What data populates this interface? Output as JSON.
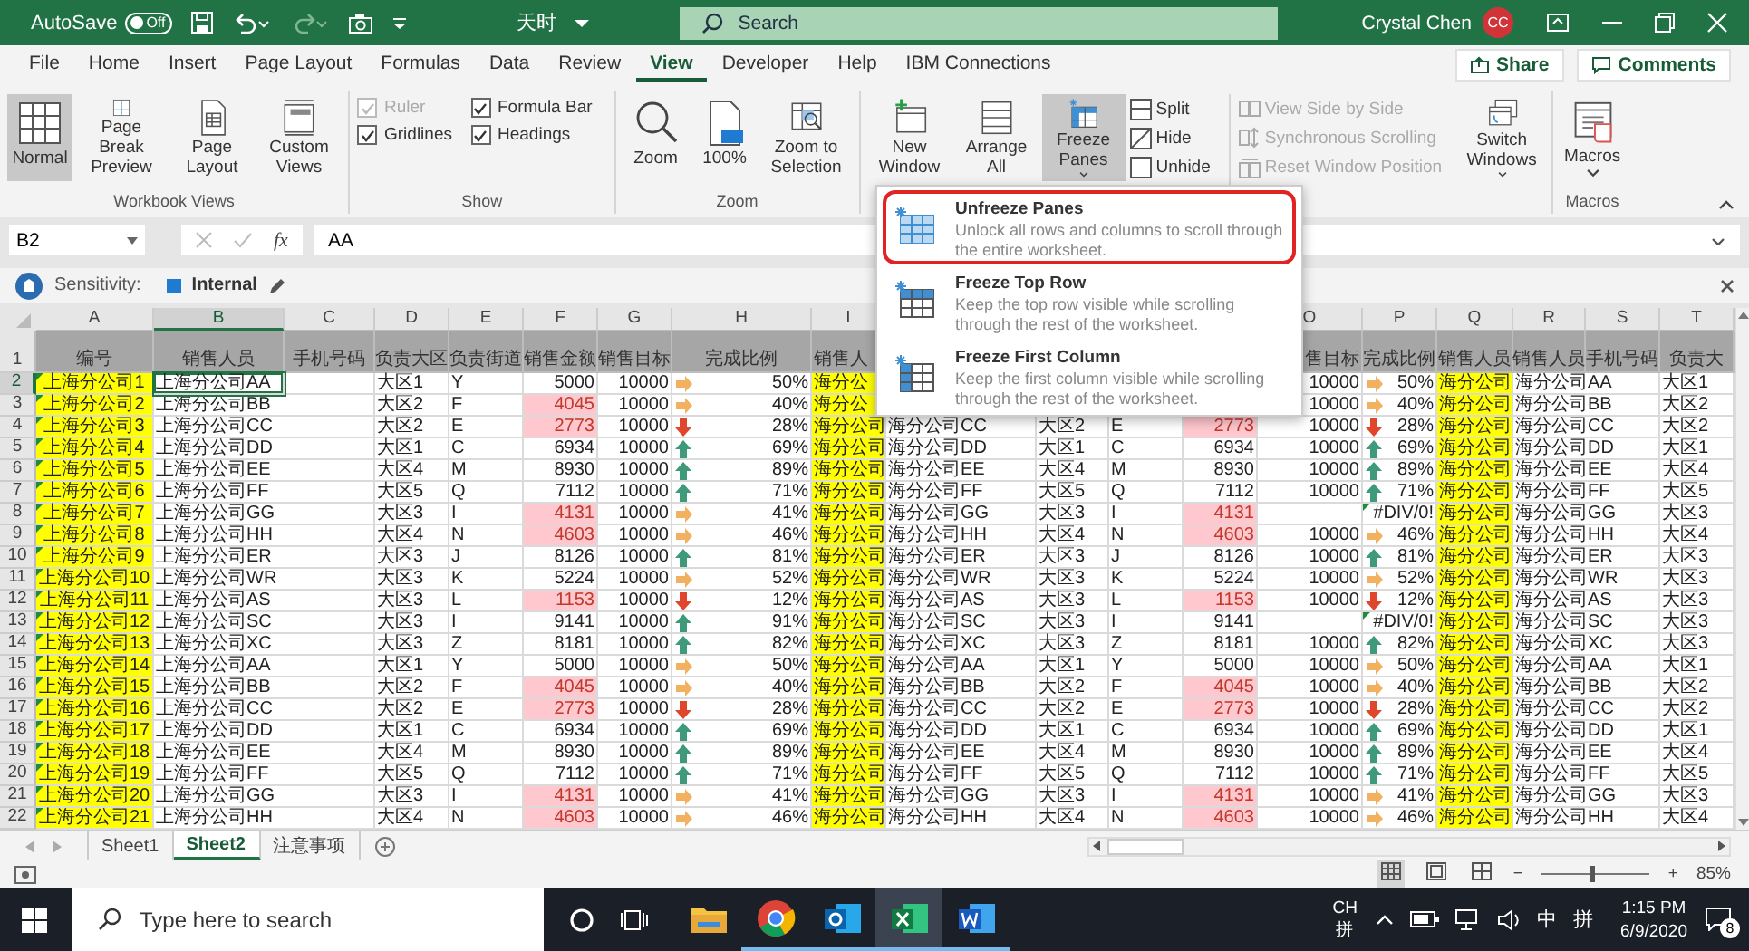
{
  "titlebar": {
    "autosave_label": "AutoSave",
    "autosave_toggle": {
      "label": "Off",
      "on": false
    },
    "title": "天时",
    "search": {
      "placeholder": "Search"
    },
    "user": "Crystal Chen",
    "avatar": "CC"
  },
  "menubar": {
    "tabs": [
      {
        "label": "File",
        "selected": false
      },
      {
        "label": "Home",
        "selected": false
      },
      {
        "label": "Insert",
        "selected": false
      },
      {
        "label": "Page Layout",
        "selected": false
      },
      {
        "label": "Formulas",
        "selected": false
      },
      {
        "label": "Data",
        "selected": false
      },
      {
        "label": "Review",
        "selected": false
      },
      {
        "label": "View",
        "selected": true
      },
      {
        "label": "Developer",
        "selected": false
      },
      {
        "label": "Help",
        "selected": false
      },
      {
        "label": "IBM Connections",
        "selected": false
      }
    ],
    "share": "Share",
    "comments": "Comments"
  },
  "ribbon": {
    "groups": [
      {
        "label": "Workbook Views",
        "items": [
          {
            "kind": "large",
            "label": "Normal",
            "selected": true
          },
          {
            "kind": "large",
            "label": "Page Break Preview",
            "selected": false
          },
          {
            "kind": "large",
            "label": "Page Layout",
            "selected": false
          },
          {
            "kind": "large",
            "label": "Custom Views",
            "selected": false
          }
        ]
      },
      {
        "label": "Show",
        "items": [
          {
            "kind": "stack",
            "items": [
              {
                "kind": "check",
                "label": "Ruler",
                "checked": true,
                "disabled": true
              },
              {
                "kind": "check",
                "label": "Gridlines",
                "checked": true,
                "disabled": false
              }
            ]
          },
          {
            "kind": "stack",
            "items": [
              {
                "kind": "check",
                "label": "Formula Bar",
                "checked": true,
                "disabled": false
              },
              {
                "kind": "check",
                "label": "Headings",
                "checked": true,
                "disabled": false
              }
            ]
          }
        ]
      },
      {
        "label": "Zoom",
        "items": [
          {
            "kind": "large",
            "label": "Zoom"
          },
          {
            "kind": "large",
            "label": "100%"
          },
          {
            "kind": "large",
            "label": "Zoom to Selection"
          }
        ]
      },
      {
        "items": [
          {
            "kind": "large",
            "label": "New Window"
          },
          {
            "kind": "large",
            "label": "Arrange All"
          },
          {
            "kind": "large",
            "label": "Freeze Panes",
            "dropdown": true,
            "expanded": true
          },
          {
            "kind": "stack",
            "items": [
              {
                "kind": "small",
                "label": "Split",
                "disabled": false
              },
              {
                "kind": "small",
                "label": "Hide",
                "disabled": false
              },
              {
                "kind": "small",
                "label": "Unhide",
                "disabled": false
              }
            ]
          },
          {
            "kind": "stack",
            "items": [
              {
                "kind": "small",
                "label": "View Side by Side",
                "disabled": true
              },
              {
                "kind": "small",
                "label": "Synchronous Scrolling",
                "disabled": true
              },
              {
                "kind": "small",
                "label": "Reset Window Position",
                "disabled": true
              }
            ]
          },
          {
            "kind": "large",
            "label": "Switch Windows",
            "dropdown": true
          }
        ]
      },
      {
        "label": "Macros",
        "items": [
          {
            "kind": "large",
            "label": "Macros",
            "dropdown": true
          }
        ]
      }
    ]
  },
  "formula_bar": {
    "name_box": "B2",
    "fx": "fx",
    "value": "AA"
  },
  "sensitivity": {
    "label": "Sensitivity:",
    "value": "Internal"
  },
  "sheet": {
    "columns": [
      {
        "letter": "A",
        "selected": false,
        "highlight": true,
        "flagged": true
      },
      {
        "letter": "B",
        "selected": true
      },
      {
        "letter": "C",
        "selected": false
      },
      {
        "letter": "D",
        "selected": false
      },
      {
        "letter": "E",
        "selected": false
      },
      {
        "letter": "F",
        "selected": false
      },
      {
        "letter": "G",
        "selected": false
      },
      {
        "letter": "H",
        "selected": false
      },
      {
        "letter": "I",
        "selected": false,
        "highlight": true
      },
      null,
      null,
      null,
      null,
      {
        "letter": "O",
        "selected": false
      },
      {
        "letter": "P",
        "selected": false
      },
      {
        "letter": "Q",
        "selected": false,
        "highlight": true
      },
      {
        "letter": "R",
        "selected": false
      },
      {
        "letter": "S",
        "selected": false
      },
      {
        "letter": "T",
        "selected": false
      }
    ],
    "rows": [
      {
        "num": "1",
        "kind": "header",
        "selected": false,
        "cells": [
          "编号",
          "销售人员",
          "手机号码",
          "负责大区",
          "负责街道",
          "销售金额",
          "销售目标",
          "完成比例",
          "销售人",
          null,
          null,
          null,
          null,
          "售目标",
          "完成比例",
          "销售人员",
          "销售人员",
          "手机号码",
          "负责大"
        ]
      },
      {
        "num": "2",
        "selected": true,
        "cells": [
          "上海分公司1",
          "上海分公司AA",
          null,
          "大区1",
          "Y",
          "5000",
          "10000",
          {
            "kind": "right",
            "text": "50%"
          },
          "海分公",
          null,
          null,
          null,
          null,
          "10000",
          {
            "kind": "right",
            "text": "50%"
          },
          "海分公司",
          "海分公司AA",
          null,
          "大区1"
        ]
      },
      {
        "num": "3",
        "selected": false,
        "cells": [
          "上海分公司2",
          "上海分公司BB",
          null,
          "大区2",
          "F",
          {
            "text": "4045",
            "low": true
          },
          "10000",
          {
            "kind": "right",
            "text": "40%"
          },
          "海分公",
          null,
          null,
          null,
          null,
          "10000",
          {
            "kind": "right",
            "text": "40%"
          },
          "海分公司",
          "海分公司BB",
          null,
          "大区2"
        ]
      },
      {
        "num": "4",
        "selected": false,
        "cells": [
          "上海分公司3",
          "上海分公司CC",
          null,
          "大区2",
          "E",
          {
            "text": "2773",
            "low": true
          },
          "10000",
          {
            "kind": "down",
            "text": "28%"
          },
          "海分公司",
          "海分公司CC",
          "大区2",
          "E",
          {
            "text": "2773",
            "low": true
          },
          "10000",
          {
            "kind": "down",
            "text": "28%"
          },
          "海分公司",
          "海分公司CC",
          null,
          "大区2"
        ]
      },
      {
        "num": "5",
        "selected": false,
        "cells": [
          "上海分公司4",
          "上海分公司DD",
          null,
          "大区1",
          "C",
          "6934",
          "10000",
          {
            "kind": "up",
            "text": "69%"
          },
          "海分公司",
          "海分公司DD",
          "大区1",
          "C",
          "6934",
          "10000",
          {
            "kind": "up",
            "text": "69%"
          },
          "海分公司",
          "海分公司DD",
          null,
          "大区1"
        ]
      },
      {
        "num": "6",
        "selected": false,
        "cells": [
          "上海分公司5",
          "上海分公司EE",
          null,
          "大区4",
          "M",
          "8930",
          "10000",
          {
            "kind": "up",
            "text": "89%"
          },
          "海分公司",
          "海分公司EE",
          "大区4",
          "M",
          "8930",
          "10000",
          {
            "kind": "up",
            "text": "89%"
          },
          "海分公司",
          "海分公司EE",
          null,
          "大区4"
        ]
      },
      {
        "num": "7",
        "selected": false,
        "cells": [
          "上海分公司6",
          "上海分公司FF",
          null,
          "大区5",
          "Q",
          "7112",
          "10000",
          {
            "kind": "up",
            "text": "71%"
          },
          "海分公司",
          "海分公司FF",
          "大区5",
          "Q",
          "7112",
          "10000",
          {
            "kind": "up",
            "text": "71%"
          },
          "海分公司",
          "海分公司FF",
          null,
          "大区5"
        ]
      },
      {
        "num": "8",
        "selected": false,
        "cells": [
          "上海分公司7",
          "上海分公司GG",
          null,
          "大区3",
          "I",
          {
            "text": "4131",
            "low": true
          },
          "10000",
          {
            "kind": "right",
            "text": "41%"
          },
          "海分公司",
          "海分公司GG",
          "大区3",
          "I",
          {
            "text": "4131",
            "low": true
          },
          null,
          {
            "text": "#DIV/0!",
            "flag": true
          },
          "海分公司",
          "海分公司GG",
          null,
          "大区3"
        ]
      },
      {
        "num": "9",
        "selected": false,
        "cells": [
          "上海分公司8",
          "上海分公司HH",
          null,
          "大区4",
          "N",
          {
            "text": "4603",
            "low": true
          },
          "10000",
          {
            "kind": "right",
            "text": "46%"
          },
          "海分公司",
          "海分公司HH",
          "大区4",
          "N",
          {
            "text": "4603",
            "low": true
          },
          "10000",
          {
            "kind": "right",
            "text": "46%"
          },
          "海分公司",
          "海分公司HH",
          null,
          "大区4"
        ]
      },
      {
        "num": "10",
        "selected": false,
        "cells": [
          "上海分公司9",
          "上海分公司ER",
          null,
          "大区3",
          "J",
          "8126",
          "10000",
          {
            "kind": "up",
            "text": "81%"
          },
          "海分公司",
          "海分公司ER",
          "大区3",
          "J",
          "8126",
          "10000",
          {
            "kind": "up",
            "text": "81%"
          },
          "海分公司",
          "海分公司ER",
          null,
          "大区3"
        ]
      },
      {
        "num": "11",
        "selected": false,
        "cells": [
          "上海分公司10",
          "上海分公司WR",
          null,
          "大区3",
          "K",
          "5224",
          "10000",
          {
            "kind": "right",
            "text": "52%"
          },
          "海分公司",
          "海分公司WR",
          "大区3",
          "K",
          "5224",
          "10000",
          {
            "kind": "right",
            "text": "52%"
          },
          "海分公司",
          "海分公司WR",
          null,
          "大区3"
        ]
      },
      {
        "num": "12",
        "selected": false,
        "cells": [
          "上海分公司11",
          "上海分公司AS",
          null,
          "大区3",
          "L",
          {
            "text": "1153",
            "low": true
          },
          "10000",
          {
            "kind": "down",
            "text": "12%"
          },
          "海分公司",
          "海分公司AS",
          "大区3",
          "L",
          {
            "text": "1153",
            "low": true
          },
          "10000",
          {
            "kind": "down",
            "text": "12%"
          },
          "海分公司",
          "海分公司AS",
          null,
          "大区3"
        ]
      },
      {
        "num": "13",
        "selected": false,
        "cells": [
          "上海分公司12",
          "上海分公司SC",
          null,
          "大区3",
          "I",
          "9141",
          "10000",
          {
            "kind": "up",
            "text": "91%"
          },
          "海分公司",
          "海分公司SC",
          "大区3",
          "I",
          "9141",
          null,
          {
            "text": "#DIV/0!",
            "flag": true
          },
          "海分公司",
          "海分公司SC",
          null,
          "大区3"
        ]
      },
      {
        "num": "14",
        "selected": false,
        "cells": [
          "上海分公司13",
          "上海分公司XC",
          null,
          "大区3",
          "Z",
          "8181",
          "10000",
          {
            "kind": "up",
            "text": "82%"
          },
          "海分公司",
          "海分公司XC",
          "大区3",
          "Z",
          "8181",
          "10000",
          {
            "kind": "up",
            "text": "82%"
          },
          "海分公司",
          "海分公司XC",
          null,
          "大区3"
        ]
      },
      {
        "num": "15",
        "selected": false,
        "cells": [
          "上海分公司14",
          "上海分公司AA",
          null,
          "大区1",
          "Y",
          "5000",
          "10000",
          {
            "kind": "right",
            "text": "50%"
          },
          "海分公司",
          "海分公司AA",
          "大区1",
          "Y",
          "5000",
          "10000",
          {
            "kind": "right",
            "text": "50%"
          },
          "海分公司",
          "海分公司AA",
          null,
          "大区1"
        ]
      },
      {
        "num": "16",
        "selected": false,
        "cells": [
          "上海分公司15",
          "上海分公司BB",
          null,
          "大区2",
          "F",
          {
            "text": "4045",
            "low": true
          },
          "10000",
          {
            "kind": "right",
            "text": "40%"
          },
          "海分公司",
          "海分公司BB",
          "大区2",
          "F",
          {
            "text": "4045",
            "low": true
          },
          "10000",
          {
            "kind": "right",
            "text": "40%"
          },
          "海分公司",
          "海分公司BB",
          null,
          "大区2"
        ]
      },
      {
        "num": "17",
        "selected": false,
        "cells": [
          "上海分公司16",
          "上海分公司CC",
          null,
          "大区2",
          "E",
          {
            "text": "2773",
            "low": true
          },
          "10000",
          {
            "kind": "down",
            "text": "28%"
          },
          "海分公司",
          "海分公司CC",
          "大区2",
          "E",
          {
            "text": "2773",
            "low": true
          },
          "10000",
          {
            "kind": "down",
            "text": "28%"
          },
          "海分公司",
          "海分公司CC",
          null,
          "大区2"
        ]
      },
      {
        "num": "18",
        "selected": false,
        "cells": [
          "上海分公司17",
          "上海分公司DD",
          null,
          "大区1",
          "C",
          "6934",
          "10000",
          {
            "kind": "up",
            "text": "69%"
          },
          "海分公司",
          "海分公司DD",
          "大区1",
          "C",
          "6934",
          "10000",
          {
            "kind": "up",
            "text": "69%"
          },
          "海分公司",
          "海分公司DD",
          null,
          "大区1"
        ]
      },
      {
        "num": "19",
        "selected": false,
        "cells": [
          "上海分公司18",
          "上海分公司EE",
          null,
          "大区4",
          "M",
          "8930",
          "10000",
          {
            "kind": "up",
            "text": "89%"
          },
          "海分公司",
          "海分公司EE",
          "大区4",
          "M",
          "8930",
          "10000",
          {
            "kind": "up",
            "text": "89%"
          },
          "海分公司",
          "海分公司EE",
          null,
          "大区4"
        ]
      },
      {
        "num": "20",
        "selected": false,
        "cells": [
          "上海分公司19",
          "上海分公司FF",
          null,
          "大区5",
          "Q",
          "7112",
          "10000",
          {
            "kind": "up",
            "text": "71%"
          },
          "海分公司",
          "海分公司FF",
          "大区5",
          "Q",
          "7112",
          "10000",
          {
            "kind": "up",
            "text": "71%"
          },
          "海分公司",
          "海分公司FF",
          null,
          "大区5"
        ]
      },
      {
        "num": "21",
        "selected": false,
        "cells": [
          "上海分公司20",
          "上海分公司GG",
          null,
          "大区3",
          "I",
          {
            "text": "4131",
            "low": true
          },
          "10000",
          {
            "kind": "right",
            "text": "41%"
          },
          "海分公司",
          "海分公司GG",
          "大区3",
          "I",
          {
            "text": "4131",
            "low": true
          },
          "10000",
          {
            "kind": "right",
            "text": "41%"
          },
          "海分公司",
          "海分公司GG",
          null,
          "大区3"
        ]
      },
      {
        "num": "22",
        "selected": false,
        "cells": [
          "上海分公司21",
          "上海分公司HH",
          null,
          "大区4",
          "N",
          {
            "text": "4603",
            "low": true
          },
          "10000",
          {
            "kind": "right",
            "text": "46%"
          },
          "海分公司",
          "海分公司HH",
          "大区4",
          "N",
          {
            "text": "4603",
            "low": true
          },
          "10000",
          {
            "kind": "right",
            "text": "46%"
          },
          "海分公司",
          "海分公司HH",
          null,
          "大区4"
        ]
      }
    ]
  },
  "freeze_menu": {
    "items": [
      {
        "title": "Unfreeze Panes",
        "description": "Unlock all rows and columns to scroll through the entire worksheet.",
        "highlighted": true
      },
      {
        "title": "Freeze Top Row",
        "description": "Keep the top row visible while scrolling through the rest of the worksheet.",
        "highlighted": false
      },
      {
        "title": "Freeze First Column",
        "description": "Keep the first column visible while scrolling through the rest of the worksheet.",
        "highlighted": false
      }
    ]
  },
  "sheet_tabs": [
    {
      "label": "Sheet1",
      "selected": false
    },
    {
      "label": "Sheet2",
      "selected": true
    },
    {
      "label": "注意事项",
      "selected": false
    }
  ],
  "status_bar": {
    "views": [
      {
        "selected": true
      },
      {
        "selected": false
      },
      {
        "selected": false
      }
    ],
    "zoom_out": "−",
    "zoom_slider": {
      "level": 0.45
    },
    "zoom_in": "+",
    "zoom": "85%"
  },
  "taskbar": {
    "search": {
      "placeholder": "Type here to search"
    },
    "apps": [
      {
        "running": false,
        "active": false
      },
      {
        "running": true,
        "active": false
      },
      {
        "running": true,
        "active": false
      },
      {
        "running": true,
        "active": true
      },
      {
        "running": true,
        "active": false
      }
    ],
    "ime_top": "CH",
    "ime_bottom": "拼",
    "ime_lang": "中",
    "ime_mode": "拼",
    "time": "1:15 PM",
    "date": "6/9/2020",
    "notifications": "8"
  }
}
